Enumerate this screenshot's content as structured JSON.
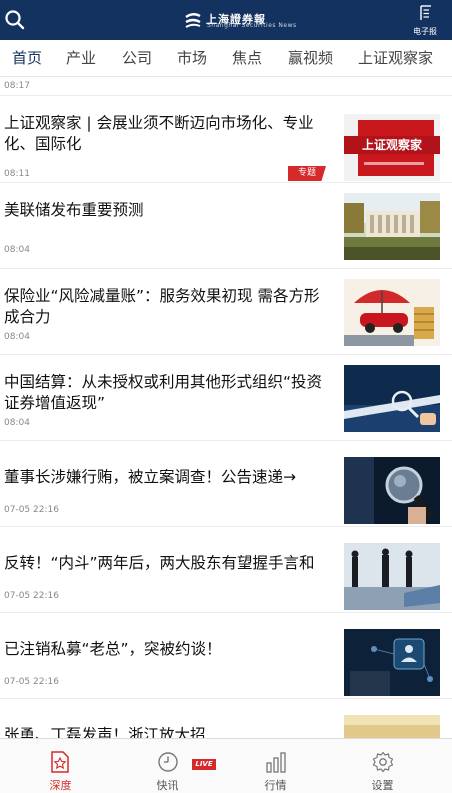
{
  "header": {
    "logo_text": "上海證券報",
    "logo_sub": "Shanghai Securities News",
    "epaper_label": "电子报"
  },
  "tabs": [
    "首页",
    "产业",
    "公司",
    "市场",
    "焦点",
    "赢视频",
    "上证观察家"
  ],
  "top_partial_time": "08:17",
  "articles": [
    {
      "title": "上证观察家 | 会展业须不断迈向市场化、专业化、国际化",
      "time": "08:11",
      "tag": "专题",
      "thumb": "observer-banner"
    },
    {
      "title": "美联储发布重要预测",
      "time": "08:04",
      "thumb": "federal-reserve-building"
    },
    {
      "title": "保险业“风险减量账”：服务效果初现 需各方形成合力",
      "time": "08:04",
      "thumb": "car-umbrella-coins"
    },
    {
      "title": "中国结算：从未授权或利用其他形式组织“投资证券增值返现”",
      "time": "08:04",
      "thumb": "magnifier-hand"
    },
    {
      "title": "董事长涉嫌行贿，被立案调查！公告速递→",
      "time": "07-05 22:16",
      "thumb": "magnifying-glass"
    },
    {
      "title": "反转！“内斗”两年后，两大股东有望握手言和",
      "time": "07-05 22:16",
      "thumb": "businessmen-silhouettes"
    },
    {
      "title": "已注销私募“老总”，突被约谈！",
      "time": "07-05 22:16",
      "thumb": "network-users"
    },
    {
      "title": "张勇、丁磊发声！浙江放大招",
      "time": "",
      "thumb": "partial"
    }
  ],
  "bottom_nav": [
    {
      "label": "深度",
      "icon": "document-star-icon"
    },
    {
      "label": "快讯",
      "icon": "clock-icon"
    },
    {
      "label": "行情",
      "icon": "bar-chart-icon"
    },
    {
      "label": "设置",
      "icon": "gear-icon"
    }
  ],
  "live_badge": "LIVE",
  "colors": {
    "header": "#14325f",
    "accent": "#d52a2a"
  }
}
